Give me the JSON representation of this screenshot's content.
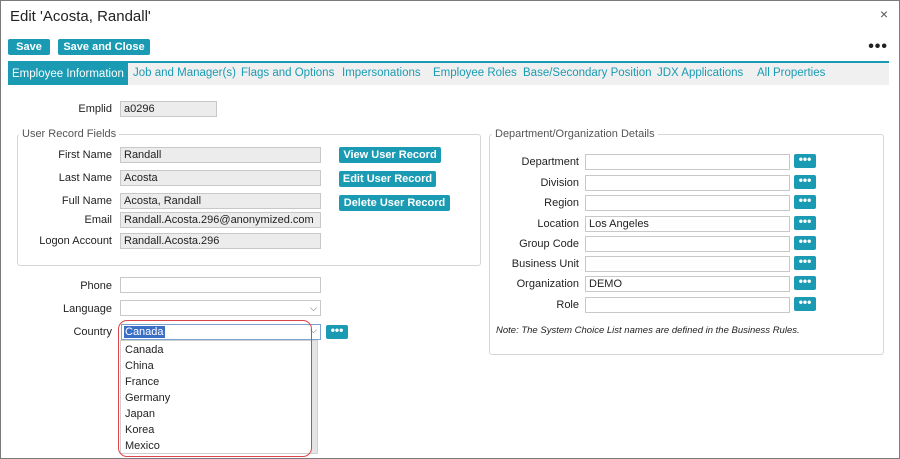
{
  "dialog": {
    "title": "Edit 'Acosta, Randall'",
    "close_glyph": "×",
    "more_glyph": "•••"
  },
  "toolbar": {
    "save_label": "Save",
    "save_close_label": "Save and Close"
  },
  "tabs": [
    {
      "label": "Employee Information"
    },
    {
      "label": "Job and Manager(s)"
    },
    {
      "label": "Flags and Options"
    },
    {
      "label": "Impersonations"
    },
    {
      "label": "Employee Roles"
    },
    {
      "label": "Base/Secondary Position"
    },
    {
      "label": "JDX Applications"
    },
    {
      "label": "All Properties"
    }
  ],
  "emplid": {
    "label": "Emplid",
    "value": "a0296"
  },
  "user_record": {
    "legend": "User Record Fields",
    "first_name": {
      "label": "First Name",
      "value": "Randall"
    },
    "last_name": {
      "label": "Last Name",
      "value": "Acosta"
    },
    "full_name": {
      "label": "Full Name",
      "value": "Acosta, Randall"
    },
    "email": {
      "label": "Email",
      "value": "Randall.Acosta.296@anonymized.com"
    },
    "logon": {
      "label": "Logon Account",
      "value": "Randall.Acosta.296"
    },
    "view_btn": "View User Record",
    "edit_btn": "Edit User Record",
    "delete_btn": "Delete User Record"
  },
  "contact": {
    "phone_label": "Phone",
    "phone_value": "",
    "language_label": "Language",
    "language_value": "",
    "country_label": "Country",
    "country_value": "Canada",
    "country_options": [
      "Canada",
      "China",
      "France",
      "Germany",
      "Japan",
      "Korea",
      "Mexico"
    ]
  },
  "dept": {
    "legend": "Department/Organization Details",
    "rows": [
      {
        "label": "Department",
        "value": ""
      },
      {
        "label": "Division",
        "value": ""
      },
      {
        "label": "Region",
        "value": ""
      },
      {
        "label": "Location",
        "value": "Los Angeles"
      },
      {
        "label": "Group Code",
        "value": ""
      },
      {
        "label": "Business Unit",
        "value": ""
      },
      {
        "label": "Organization",
        "value": "DEMO"
      },
      {
        "label": "Role",
        "value": ""
      }
    ],
    "note": "Note: The System Choice List names are defined in the Business Rules."
  },
  "glyphs": {
    "dots": "•••",
    "chevron": "⌵"
  },
  "colors": {
    "accent": "#1a9bb3",
    "highlight": "#d9464a",
    "selection": "#3b6fc6"
  }
}
